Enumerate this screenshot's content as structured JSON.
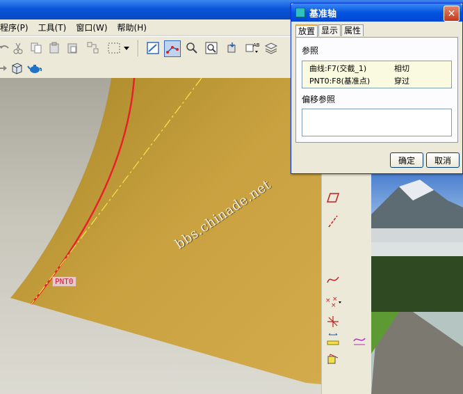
{
  "menu": {
    "items": [
      "程序(P)",
      "工具(T)",
      "窗口(W)",
      "帮助(H)"
    ]
  },
  "icons": {
    "toolbar1": [
      "undo-icon",
      "cut-icon",
      "copy-icon",
      "paste-icon",
      "paste-special-icon",
      "regenerate-icon",
      "select-box-icon",
      "dropdown-arrow-icon",
      "datum-display-icon",
      "datum-axis-toggle-icon",
      "spin-center-icon",
      "zoom-icon",
      "repaint-icon",
      "view-mode-icon",
      "layers-icon"
    ],
    "toolbar2": [
      "redo-icon",
      "cube-view-icon",
      "teapot-icon"
    ],
    "right_toolbar": [
      "datum-plane-icon",
      "datum-axis-icon",
      "datum-curve-icon",
      "datum-point-icon",
      "coord-sys-icon",
      "analysis-icon",
      "sketch-icon"
    ]
  },
  "viewport": {
    "watermark": "bbs.chinade.net",
    "point_label": "PNT0"
  },
  "dialog": {
    "title": "基准轴",
    "close_glyph": "✕",
    "tabs": [
      "放置",
      "显示",
      "属性"
    ],
    "selected_tab": "放置",
    "references_label": "参照",
    "references": [
      {
        "name": "曲线:F7(交截_1)",
        "type": "相切"
      },
      {
        "name": "PNT0:F8(基准点)",
        "type": "穿过"
      }
    ],
    "offset_label": "偏移参照",
    "ok_label": "确定",
    "cancel_label": "取消"
  },
  "colors": {
    "surface": "#c9a13f",
    "curve": "#e8202a",
    "axis_line": "#f2e04a",
    "titlebar": "#0a56d8"
  }
}
